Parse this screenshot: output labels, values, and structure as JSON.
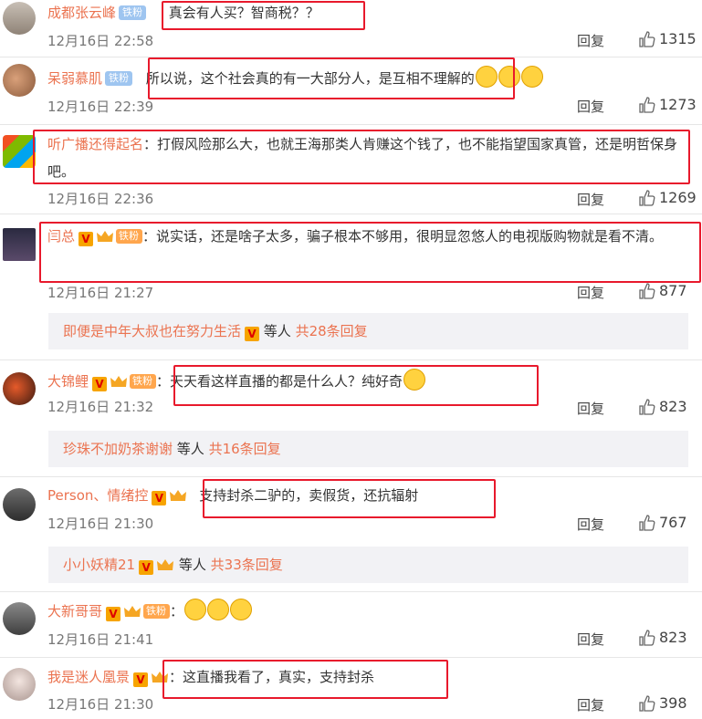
{
  "comments": [
    {
      "name": "成都张云峰",
      "badge": "铁粉",
      "text": "真会有人买？智商税？？",
      "time": "12月16日 22:58",
      "reply": "回复",
      "likes": "1315"
    },
    {
      "name": "呆弱慕肌",
      "badge": "铁粉",
      "text": "所以说，这个社会真的有一大部分人，是互相不理解的",
      "time": "12月16日 22:39",
      "reply": "回复",
      "likes": "1273"
    },
    {
      "name": "听广播还得起名",
      "text": "打假风险那么大，也就王海那类人肯赚这个钱了，也不能指望国家真管，还是明哲保身吧。",
      "time": "12月16日 22:36",
      "reply": "回复",
      "likes": "1269"
    },
    {
      "name": "闫总",
      "vip": "V",
      "badge": "铁粉",
      "text": "说实话，还是啥子太多，骗子根本不够用，很明显忽悠人的电视版购物就是看不清。",
      "time": "12月16日 21:27",
      "reply": "回复",
      "likes": "877",
      "sub": {
        "user": "即便是中年大叔也在努力生活",
        "vip": "V",
        "mid": "等人",
        "more": "共28条回复"
      }
    },
    {
      "name": "大锦鲤",
      "vip": "V",
      "badge": "铁粉",
      "text": "天天看这样直播的都是什么人？纯好奇",
      "time": "12月16日 21:32",
      "reply": "回复",
      "likes": "823",
      "sub": {
        "user": "珍珠不加奶茶谢谢",
        "mid": "等人",
        "more": "共16条回复"
      }
    },
    {
      "name": "Person、情绪控",
      "vip": "V",
      "text": "支持封杀二驴的，卖假货，还抗辐射",
      "time": "12月16日 21:30",
      "reply": "回复",
      "likes": "767",
      "sub": {
        "user": "小小妖精21",
        "vip": "V",
        "mid": "等人",
        "more": "共33条回复"
      }
    },
    {
      "name": "大新哥哥",
      "vip": "V",
      "badge": "铁粉",
      "text": "",
      "time": "12月16日 21:41",
      "reply": "回复",
      "likes": "823"
    },
    {
      "name": "我是迷人凰景",
      "vip": "V",
      "text": "这直播我看了，真实，支持封杀",
      "time": "12月16日 21:30",
      "reply": "回复",
      "likes": "398"
    }
  ],
  "colors": {
    "name": "#eb7350",
    "highlight": "#e8192c",
    "subbg": "#f2f2f5"
  },
  "icons": [
    "thumbs-up-icon",
    "vip-icon",
    "crown-level-icon",
    "emoji-icon"
  ]
}
